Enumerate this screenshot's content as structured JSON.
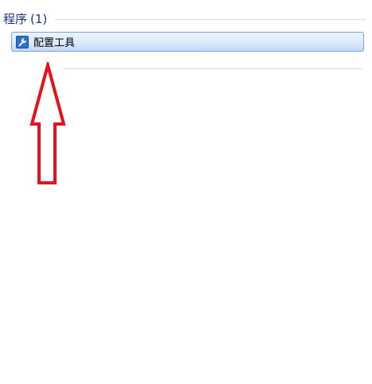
{
  "group": {
    "title": "程序",
    "count": "(1)"
  },
  "results": [
    {
      "label": "配置工具",
      "icon": "wrench-icon"
    }
  ],
  "colors": {
    "group_title": "#1e3287",
    "item_border": "#7da2ce",
    "item_background": "#dcebfc",
    "icon_background": "#2f6fd0",
    "arrow": "#e8101a"
  }
}
